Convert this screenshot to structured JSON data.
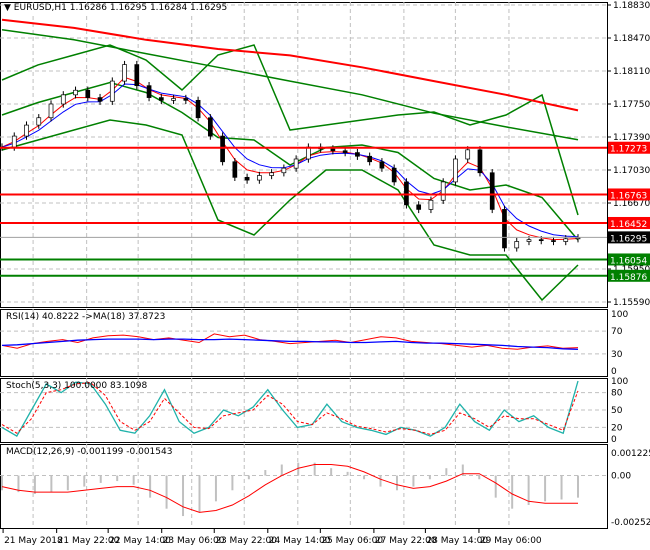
{
  "header": {
    "symbol": "EURUSD,H1",
    "ohlc": "1.16286 1.16295 1.16284 1.16295"
  },
  "colors": {
    "bull_bear": "#000000",
    "ma_red": "#ff0000",
    "ma_green": "#008000",
    "rsi": "#ff0000",
    "rsi_ma": "#0000ff",
    "stoch_main": "#20b2aa",
    "stoch_signal": "#ff0000",
    "macd_hist": "#c0c0c0",
    "macd_signal": "#ff0000"
  },
  "chart_data": [
    {
      "type": "line",
      "title": "EURUSD,H1",
      "ylim": [
        1.1559,
        1.1883
      ],
      "y_ticks": [
        "1.18830",
        "1.18470",
        "1.18110",
        "1.17750",
        "1.17390",
        "1.17030",
        "1.16670",
        "1.15950",
        "1.15590"
      ],
      "x_ticks": [
        "21 May 2018",
        "21 May 22:00",
        "22 May 14:00",
        "23 May 06:00",
        "23 May 22:00",
        "24 May 14:00",
        "25 May 06:00",
        "27 May 22:00",
        "28 May 14:00",
        "29 May 06:00"
      ],
      "close": [
        1.1728,
        1.174,
        1.1752,
        1.176,
        1.1775,
        1.1785,
        1.179,
        1.1782,
        1.1778,
        1.18,
        1.1818,
        1.1795,
        1.1782,
        1.1779,
        1.1781,
        1.1779,
        1.176,
        1.174,
        1.1712,
        1.1695,
        1.1692,
        1.1697,
        1.17,
        1.1705,
        1.1715,
        1.1728,
        1.1726,
        1.1724,
        1.1722,
        1.1718,
        1.1712,
        1.1705,
        1.169,
        1.1665,
        1.166,
        1.167,
        1.169,
        1.1715,
        1.1725,
        1.17,
        1.166,
        1.1618,
        1.1625,
        1.1627,
        1.1626,
        1.1625,
        1.1628,
        1.1629
      ],
      "ma_red": [
        1.1867,
        1.1858,
        1.1845,
        1.1835,
        1.1828,
        1.1815,
        1.18,
        1.1785,
        1.1768
      ],
      "ma_green": [
        1.1856,
        1.1845,
        1.183,
        1.1815,
        1.18,
        1.1785,
        1.1765,
        1.175,
        1.1736
      ],
      "bb_upper": [
        1.18012,
        1.18176,
        1.18285,
        1.18394,
        1.1823,
        1.17903,
        1.18285,
        1.18394,
        1.17466,
        1.17521,
        1.17575,
        1.1763,
        1.17663,
        1.17521,
        1.1763,
        1.17848,
        1.16539
      ],
      "bb_lower": [
        1.17248,
        1.17357,
        1.17466,
        1.17575,
        1.17521,
        1.17412,
        1.16484,
        1.16321,
        1.16703,
        1.1703,
        1.1703,
        1.16812,
        1.16212,
        1.16103,
        1.16103,
        1.15612,
        1.15994
      ],
      "levels": [
        {
          "value": "1.17273",
          "color": "#ff0000"
        },
        {
          "value": "1.16763",
          "color": "#ff0000"
        },
        {
          "value": "1.16452",
          "color": "#ff0000"
        },
        {
          "value": "1.16054",
          "color": "#008000"
        },
        {
          "value": "1.15876",
          "color": "#008000"
        }
      ],
      "current_price": "1.16295"
    },
    {
      "type": "line",
      "title": "RSI(14) 40.8222  ->MA(18) 37.8723",
      "ylim": [
        0,
        100
      ],
      "y_ticks": [
        "100",
        "70",
        "30",
        "0"
      ],
      "rsi": [
        45,
        40,
        48,
        52,
        55,
        50,
        58,
        62,
        63,
        60,
        55,
        58,
        54,
        50,
        65,
        60,
        63,
        55,
        52,
        48,
        50,
        52,
        54,
        50,
        55,
        60,
        58,
        52,
        50,
        48,
        45,
        42,
        45,
        40,
        38,
        42,
        44,
        40,
        41
      ],
      "rsi_ma": [
        45,
        46,
        48,
        50,
        52,
        54,
        55,
        56,
        56,
        56,
        55,
        56,
        56,
        55,
        55,
        56,
        55,
        54,
        53,
        52,
        52,
        51,
        51,
        50,
        50,
        51,
        52,
        50,
        49,
        49,
        48,
        47,
        46,
        45,
        43,
        42,
        41,
        39,
        38
      ]
    },
    {
      "type": "line",
      "title": "Stoch(5,3,3) 100.0000 83.1098",
      "ylim": [
        0,
        100
      ],
      "y_ticks": [
        "100",
        "80",
        "50",
        "20",
        "0"
      ],
      "main": [
        20,
        5,
        50,
        95,
        80,
        98,
        95,
        60,
        15,
        10,
        40,
        85,
        30,
        10,
        20,
        50,
        40,
        55,
        85,
        50,
        20,
        25,
        60,
        30,
        20,
        15,
        8,
        20,
        15,
        5,
        20,
        60,
        30,
        15,
        50,
        30,
        40,
        20,
        10,
        100
      ],
      "signal": [
        25,
        10,
        35,
        80,
        85,
        95,
        97,
        75,
        30,
        15,
        30,
        70,
        45,
        20,
        18,
        40,
        45,
        50,
        75,
        60,
        30,
        25,
        45,
        35,
        22,
        18,
        12,
        18,
        15,
        8,
        15,
        45,
        35,
        20,
        40,
        35,
        35,
        25,
        15,
        83
      ]
    },
    {
      "type": "bar",
      "title": "MACD(12,26,9) -0.001199 -0.001543",
      "ylim": [
        -0.002523,
        0.001225
      ],
      "y_ticks": [
        "0.001225",
        "0.00",
        "-0.002523"
      ],
      "histogram": [
        -0.0008,
        -0.0009,
        -0.001,
        -0.0009,
        -0.0008,
        -0.0006,
        -0.0004,
        -0.0003,
        -0.0005,
        -0.0012,
        -0.0018,
        -0.0022,
        -0.002,
        -0.0014,
        -0.0008,
        -0.0002,
        0.0003,
        0.0006,
        0.0007,
        0.0007,
        0.0004,
        0.0002,
        -0.0002,
        -0.0006,
        -0.0008,
        -0.0006,
        -0.0002,
        0.0004,
        0.0006,
        -0.0002,
        -0.0012,
        -0.0018,
        -0.0016,
        -0.0014,
        -0.0013,
        -0.0012
      ],
      "signal": [
        -0.0006,
        -0.0008,
        -0.0009,
        -0.0009,
        -0.0009,
        -0.0008,
        -0.0007,
        -0.0006,
        -0.0006,
        -0.0008,
        -0.0012,
        -0.0017,
        -0.002,
        -0.0019,
        -0.0016,
        -0.0011,
        -0.0005,
        0.0,
        0.0004,
        0.0006,
        0.0006,
        0.0005,
        0.0002,
        -0.0002,
        -0.0005,
        -0.0007,
        -0.0006,
        -0.0003,
        0.0001,
        0.0001,
        -0.0004,
        -0.001,
        -0.0014,
        -0.0015,
        -0.0015,
        -0.0015
      ]
    }
  ]
}
